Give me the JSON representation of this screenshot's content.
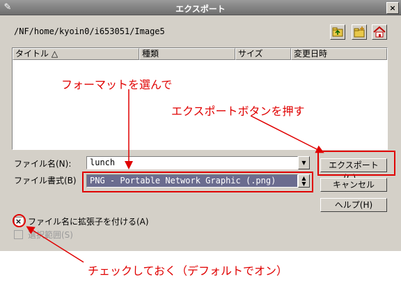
{
  "window": {
    "title": "エクスポート",
    "close_label": "×"
  },
  "toolbar": {
    "path": "/NF/home/kyoin0/i653051/Image5",
    "icons": [
      "folder-up-icon",
      "new-folder-icon",
      "home-icon"
    ]
  },
  "file_list": {
    "columns": [
      "タイトル △",
      "種類",
      "サイズ",
      "変更日時"
    ],
    "rows": []
  },
  "filename": {
    "label": "ファイル名(N):",
    "value": "lunch"
  },
  "format": {
    "label": "ファイル書式(B)",
    "value": "PNG - Portable Network Graphic (.png)"
  },
  "buttons": {
    "export": "エクスポート(C)...",
    "cancel": "キャンセル",
    "help": "ヘルプ(H)"
  },
  "options": {
    "add_extension": {
      "label": "ファイル名に拡張子を付ける(A)",
      "checked": true,
      "mark": "×"
    },
    "selection_range": {
      "label": "選択範囲(S)",
      "enabled": false
    }
  },
  "annotations": {
    "choose_format": "フォーマットを選んで",
    "press_export": "エクスポートボタンを押す",
    "check_note": "チェックしておく（デフォルトでオン）"
  },
  "colors": {
    "annotation": "#e00000",
    "titlebar": "#7a7a7a",
    "dialog": "#d4d0c8",
    "selection": "#6b6c8f"
  }
}
